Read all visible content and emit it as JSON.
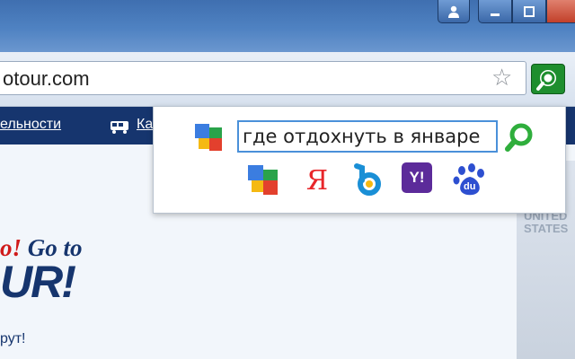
{
  "browser": {
    "url": "otour.com"
  },
  "page": {
    "nav": {
      "item1": "ельности",
      "item2": "Ка"
    },
    "hero": {
      "go_prefix": "o!",
      "go_text": " Go to",
      "brand": "UR!",
      "subtitle": "рут!"
    },
    "map_text": [
      "UNITED",
      "STATES"
    ]
  },
  "popup": {
    "search_value": "где отдохнуть в январе",
    "engines": [
      {
        "icon": "google-icon"
      },
      {
        "icon": "yandex-icon",
        "label": "Я"
      },
      {
        "icon": "bing-icon"
      },
      {
        "icon": "yahoo-icon",
        "label": "Y!"
      },
      {
        "icon": "baidu-icon",
        "label": "du"
      }
    ]
  },
  "colors": {
    "navbar": "#16356e",
    "extension_green": "#1e8e2e",
    "input_border": "#4a90d9",
    "titlebar": "#4f82c2"
  }
}
